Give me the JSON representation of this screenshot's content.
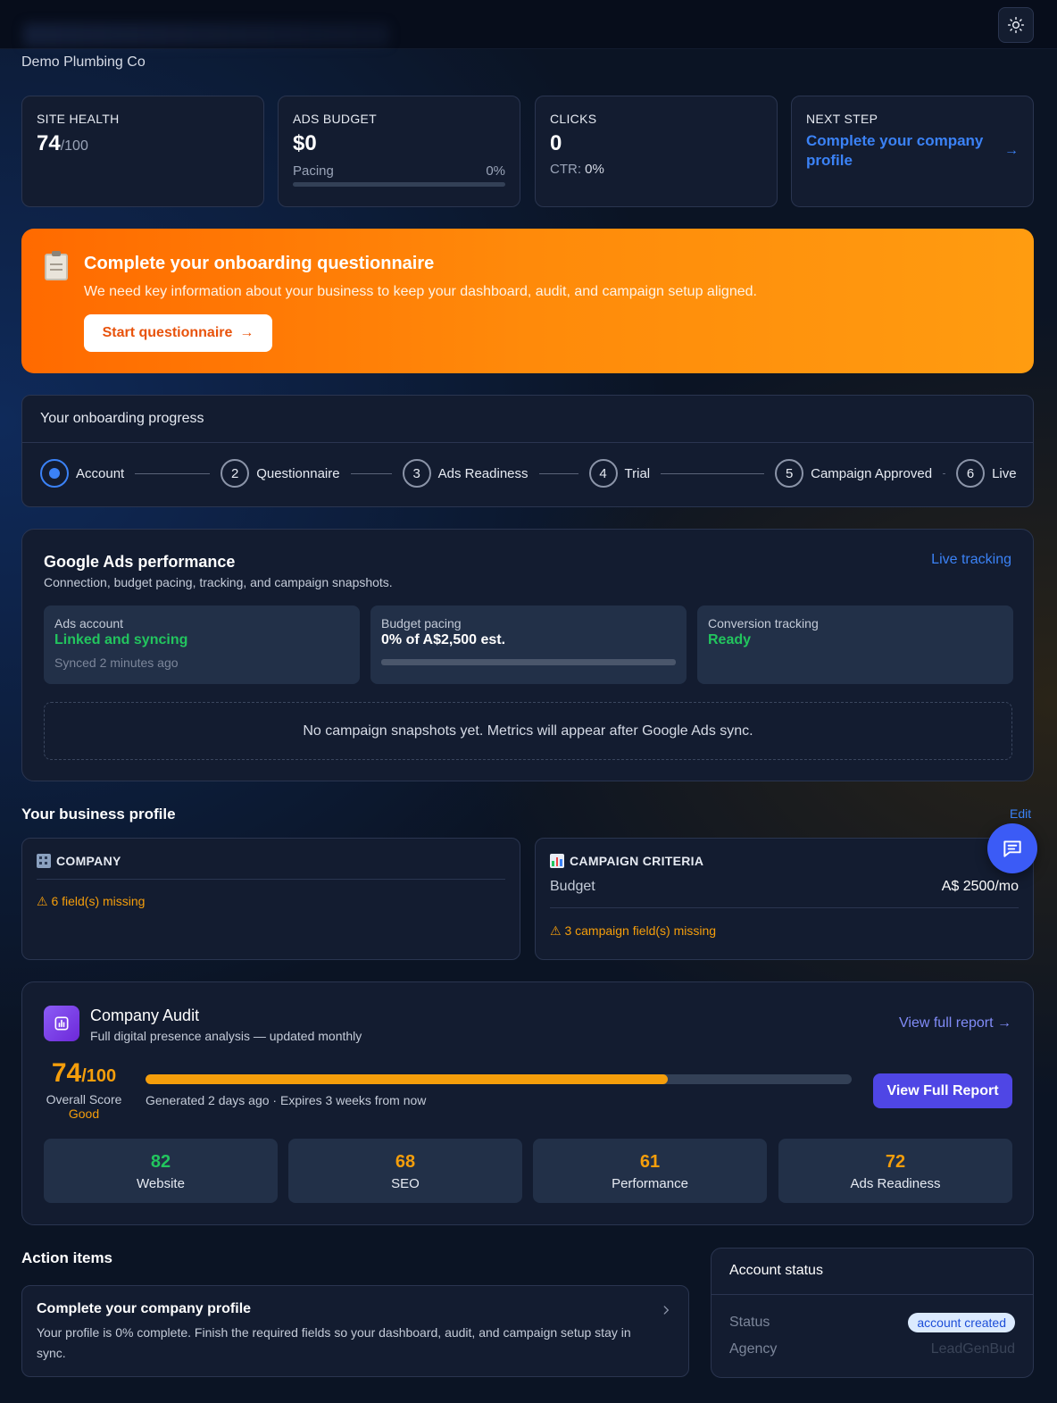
{
  "header": {
    "company_name": "Demo Plumbing Co"
  },
  "stats": {
    "site_health": {
      "label": "SITE HEALTH",
      "value": "74",
      "suffix": "/100"
    },
    "ads_budget": {
      "label": "ADS BUDGET",
      "value": "$0",
      "pacing_label": "Pacing",
      "pacing_percent": "0%",
      "pacing_fraction": 0
    },
    "clicks": {
      "label": "CLICKS",
      "value": "0",
      "ctr_label": "CTR:",
      "ctr_value": "0%"
    },
    "next_step": {
      "label": "NEXT STEP",
      "text": "Complete your company profile",
      "arrow": "→"
    }
  },
  "banner": {
    "icon": "clipboard-icon",
    "title": "Complete your onboarding questionnaire",
    "description": "We need key information about your business to keep your dashboard, audit, and campaign setup aligned.",
    "button_label": "Start questionnaire",
    "button_arrow": "→"
  },
  "onboarding": {
    "title": "Your onboarding progress",
    "steps": [
      {
        "number": "",
        "label": "Account",
        "active": true
      },
      {
        "number": "2",
        "label": "Questionnaire"
      },
      {
        "number": "3",
        "label": "Ads Readiness"
      },
      {
        "number": "4",
        "label": "Trial"
      },
      {
        "number": "5",
        "label": "Campaign Approved"
      },
      {
        "number": "6",
        "label": "Live"
      }
    ]
  },
  "google_ads": {
    "title": "Google Ads performance",
    "subtitle": "Connection, budget pacing, tracking, and campaign snapshots.",
    "live_link": "Live tracking",
    "account": {
      "label": "Ads account",
      "status": "Linked and syncing",
      "synced": "Synced 2 minutes ago"
    },
    "budget": {
      "label": "Budget pacing",
      "value": "0% of A$2,500 est.",
      "fraction": 0
    },
    "tracking": {
      "label": "Conversion tracking",
      "status": "Ready"
    },
    "empty_message": "No campaign snapshots yet. Metrics will appear after Google Ads sync."
  },
  "business_profile": {
    "title": "Your business profile",
    "edit_label": "Edit",
    "company": {
      "icon": "office-building-icon",
      "title": "COMPANY",
      "warning": "⚠ 6 field(s) missing"
    },
    "campaign": {
      "icon": "bar-chart-icon",
      "title": "CAMPAIGN CRITERIA",
      "budget_label": "Budget",
      "budget_value": "A$ 2500/mo",
      "warning": "⚠ 3 campaign field(s) missing"
    }
  },
  "audit": {
    "title": "Company Audit",
    "subtitle": "Full digital presence analysis — updated monthly",
    "view_link": "View full report →",
    "score": "74",
    "score_suffix": "/100",
    "overall_label": "Overall Score",
    "rating": "Good",
    "score_fraction": 0.74,
    "generated": "Generated 2 days ago · Expires 3 weeks from now",
    "button_label": "View Full Report",
    "categories": [
      {
        "score": "82",
        "label": "Website",
        "color": "#22c55e"
      },
      {
        "score": "68",
        "label": "SEO",
        "color": "#f59e0b"
      },
      {
        "score": "61",
        "label": "Performance",
        "color": "#f59e0b"
      },
      {
        "score": "72",
        "label": "Ads Readiness",
        "color": "#f59e0b"
      }
    ]
  },
  "action_items": {
    "title": "Action items",
    "items": [
      {
        "title": "Complete your company profile",
        "description": "Your profile is 0% complete. Finish the required fields so your dashboard, audit, and campaign setup stay in sync."
      }
    ]
  },
  "account_status": {
    "title": "Account status",
    "status_label": "Status",
    "status_value": "account created",
    "agency_label": "Agency",
    "agency_value": "LeadGenBud"
  },
  "colors": {
    "accent_blue": "#3b82f6",
    "banner_orange": "#ff7a00",
    "success_green": "#22c55e",
    "warning_amber": "#f59e0b",
    "primary_button": "#4f46e5"
  }
}
